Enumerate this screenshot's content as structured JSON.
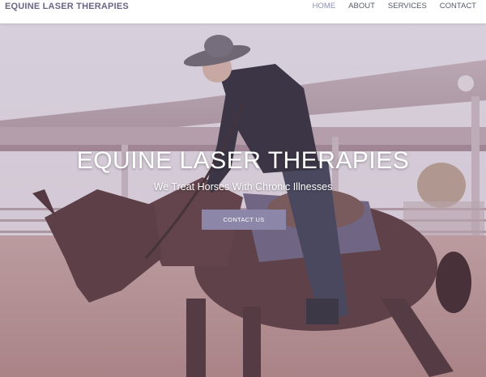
{
  "navbar": {
    "brand": "EQUINE LASER THERAPIES",
    "links": [
      {
        "label": "HOME",
        "active": true
      },
      {
        "label": "ABOUT",
        "active": false
      },
      {
        "label": "SERVICES",
        "active": false
      },
      {
        "label": "CONTACT",
        "active": false
      }
    ]
  },
  "hero": {
    "title": "EQUINE LASER THERAPIES",
    "subtitle": "We Treat Horses With Chronic Illnesses",
    "button_label": "CONTACT US"
  },
  "colors": {
    "brand": "#6b6585",
    "accent_button": "#8c86a8",
    "active_nav": "#8a8fb0"
  }
}
